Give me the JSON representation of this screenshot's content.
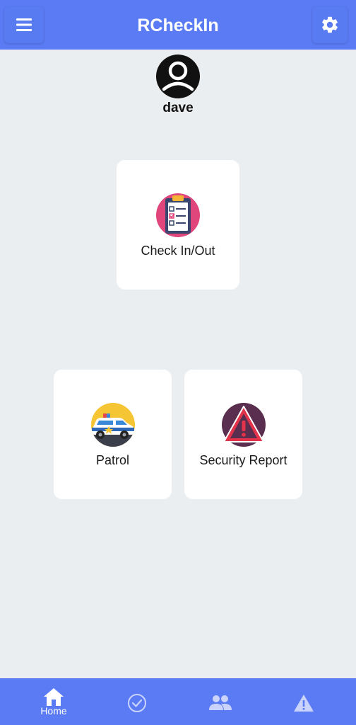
{
  "header": {
    "title": "RCheckIn",
    "menu_icon": "hamburger-menu-icon",
    "settings_icon": "gear-icon",
    "color": "#5b7bf5"
  },
  "profile": {
    "username": "dave",
    "avatar_icon": "user-avatar-icon"
  },
  "cards": {
    "checkin": {
      "label": "Check In/Out",
      "icon": "clipboard-checklist-icon"
    },
    "patrol": {
      "label": "Patrol",
      "icon": "police-car-icon"
    },
    "report": {
      "label": "Security Report",
      "icon": "warning-triangle-icon"
    }
  },
  "bottom_nav": {
    "items": [
      {
        "label": "Home",
        "icon": "home-icon",
        "active": true
      },
      {
        "label": "",
        "icon": "check-circle-icon",
        "active": false
      },
      {
        "label": "",
        "icon": "people-icon",
        "active": false
      },
      {
        "label": "",
        "icon": "alert-triangle-icon",
        "active": false
      }
    ]
  },
  "colors": {
    "background": "#ebeef0",
    "accent": "#5b7bf5",
    "card": "#ffffff"
  }
}
